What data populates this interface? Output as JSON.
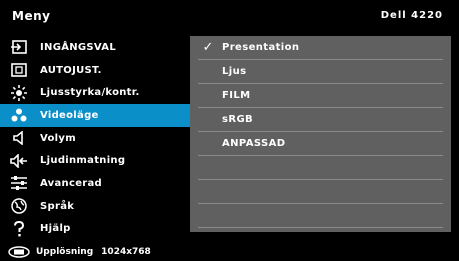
{
  "header": {
    "title": "Meny",
    "model": "Dell 4220"
  },
  "menu": {
    "items": [
      {
        "label": "INGÅNGSVAL",
        "icon": "input-source-icon"
      },
      {
        "label": "AUTOJUST.",
        "icon": "auto-adjust-icon"
      },
      {
        "label": "Ljusstyrka/kontr.",
        "icon": "brightness-icon"
      },
      {
        "label": "Videoläge",
        "icon": "video-mode-icon",
        "selected": true
      },
      {
        "label": "Volym",
        "icon": "volume-icon"
      },
      {
        "label": "Ljudinmatning",
        "icon": "audio-input-icon"
      },
      {
        "label": "Avancerad",
        "icon": "advanced-settings-icon"
      },
      {
        "label": "Språk",
        "icon": "language-icon"
      },
      {
        "label": "Hjälp",
        "icon": "help-icon"
      }
    ]
  },
  "panel": {
    "options": [
      {
        "label": "Presentation",
        "checked": true
      },
      {
        "label": "Ljus"
      },
      {
        "label": "FILM"
      },
      {
        "label": "sRGB"
      },
      {
        "label": "ANPASSAD"
      },
      {
        "label": ""
      },
      {
        "label": ""
      },
      {
        "label": ""
      }
    ]
  },
  "footer": {
    "label": "Upplösning",
    "value": "1024x768"
  },
  "colors": {
    "highlight": "#0a8fc9",
    "panel": "#606060",
    "background": "#000000"
  }
}
